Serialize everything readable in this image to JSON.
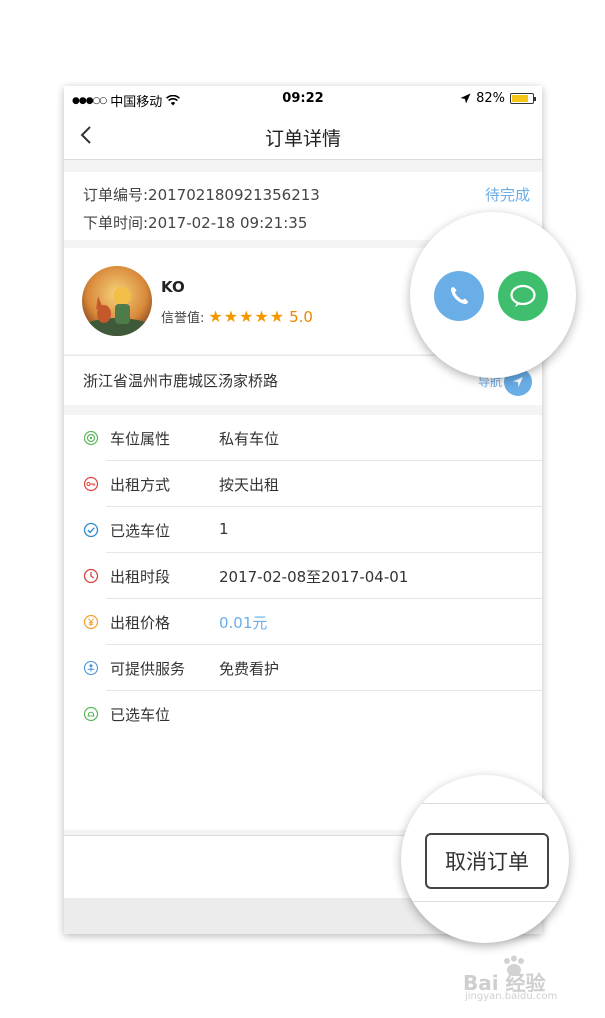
{
  "status_bar": {
    "signal": "●●●○○",
    "carrier": "中国移动",
    "wifi_icon": "wifi-icon",
    "time": "09:22",
    "location_icon": "location-arrow-icon",
    "battery_percent": "82%",
    "battery_level": 0.82
  },
  "nav": {
    "title": "订单详情",
    "back_icon": "chevron-left-icon"
  },
  "order": {
    "number": "订单编号:201702180921356213",
    "time": "下单时间:2017-02-18 09:21:35",
    "status": "待完成"
  },
  "user": {
    "name": "KO",
    "credit_label": "信誉值:",
    "stars": "★★★★★",
    "rating_value": 5,
    "score": "5.0"
  },
  "address": {
    "text": "浙江省温州市鹿城区汤家桥路",
    "nav_label": "导航"
  },
  "details": [
    {
      "label": "车位属性",
      "value": "私有车位",
      "icon": "target-icon",
      "color": "#5cb85c"
    },
    {
      "label": "出租方式",
      "value": "按天出租",
      "icon": "key-icon",
      "color": "#e0453a"
    },
    {
      "label": "已选车位",
      "value": "1",
      "icon": "check-circle-icon",
      "color": "#2e8bd0"
    },
    {
      "label": "出租时段",
      "value": "2017-02-08至2017-04-01",
      "icon": "clock-icon",
      "color": "#d9453a"
    },
    {
      "label": "出租价格",
      "value": "0.01元",
      "icon": "yen-icon",
      "color": "#f0a030"
    },
    {
      "label": "可提供服务",
      "value": "免费看护",
      "icon": "service-icon",
      "color": "#4a90d9"
    },
    {
      "label": "已选车位",
      "value": "",
      "icon": "parking-icon",
      "color": "#5cb85c"
    }
  ],
  "actions": {
    "call_icon": "phone-icon",
    "message_icon": "message-icon",
    "cancel_label": "取消订单"
  },
  "colors": {
    "accent_blue": "#6aaee8",
    "call_blue": "#6aaee8",
    "message_green": "#3fbf6e",
    "star_orange": "#f39800"
  },
  "watermark": {
    "text": "Bai 经验",
    "url": "jingyan.baidu.com"
  }
}
